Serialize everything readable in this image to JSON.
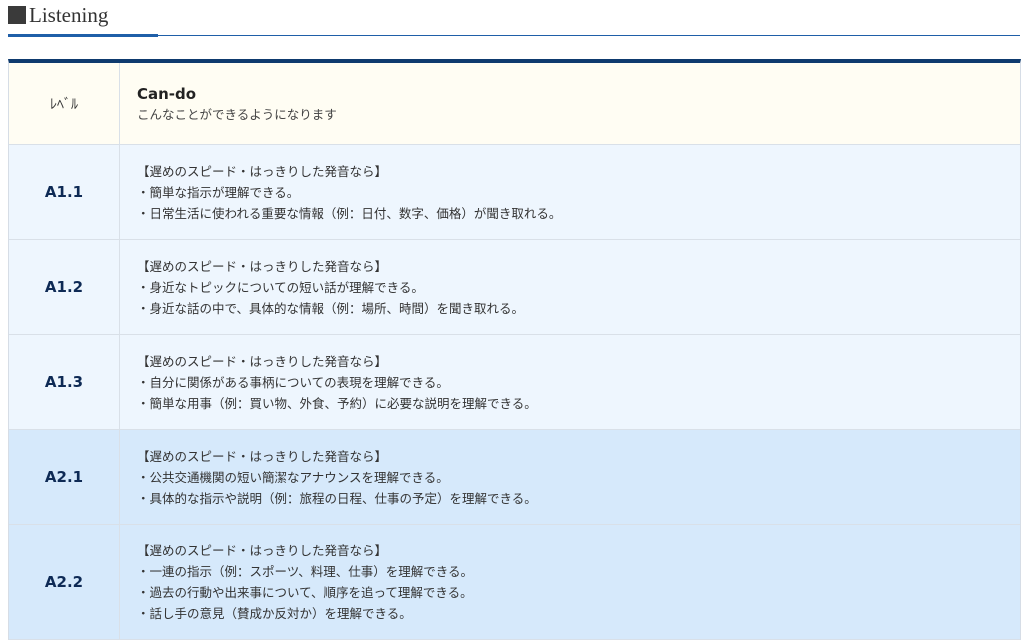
{
  "section": {
    "title": "Listening"
  },
  "table": {
    "header": {
      "level_label": "ﾚﾍﾞﾙ",
      "cando_title": "Can-do",
      "cando_subtitle": "こんなことができるようになります"
    },
    "rows": [
      {
        "level": "A1.1",
        "condition": "【遅めのスピード・はっきりした発音なら】",
        "items": [
          "・簡単な指示が理解できる。",
          "・日常生活に使われる重要な情報（例：日付、数字、価格）が聞き取れる。"
        ]
      },
      {
        "level": "A1.2",
        "condition": "【遅めのスピード・はっきりした発音なら】",
        "items": [
          "・身近なトピックについての短い話が理解できる。",
          "・身近な話の中で、具体的な情報（例：場所、時間）を聞き取れる。"
        ]
      },
      {
        "level": "A1.3",
        "condition": "【遅めのスピード・はっきりした発音なら】",
        "items": [
          "・自分に関係がある事柄についての表現を理解できる。",
          "・簡単な用事（例：買い物、外食、予約）に必要な説明を理解できる。"
        ]
      },
      {
        "level": "A2.1",
        "condition": "【遅めのスピード・はっきりした発音なら】",
        "items": [
          "・公共交通機関の短い簡潔なアナウンスを理解できる。",
          "・具体的な指示や説明（例：旅程の日程、仕事の予定）を理解できる。"
        ]
      },
      {
        "level": "A2.2",
        "condition": "【遅めのスピード・はっきりした発音なら】",
        "items": [
          "・一連の指示（例：スポーツ、料理、仕事）を理解できる。",
          "・過去の行動や出来事について、順序を追って理解できる。",
          "・話し手の意見（賛成か反対か）を理解できる。"
        ]
      }
    ]
  },
  "colors": {
    "accent": "#1f5fa8",
    "table_top_border": "#0e3a6e",
    "header_bg": "#fffdf3",
    "a1_bg": "#eef6fe",
    "a2_bg": "#d6e9fb"
  }
}
